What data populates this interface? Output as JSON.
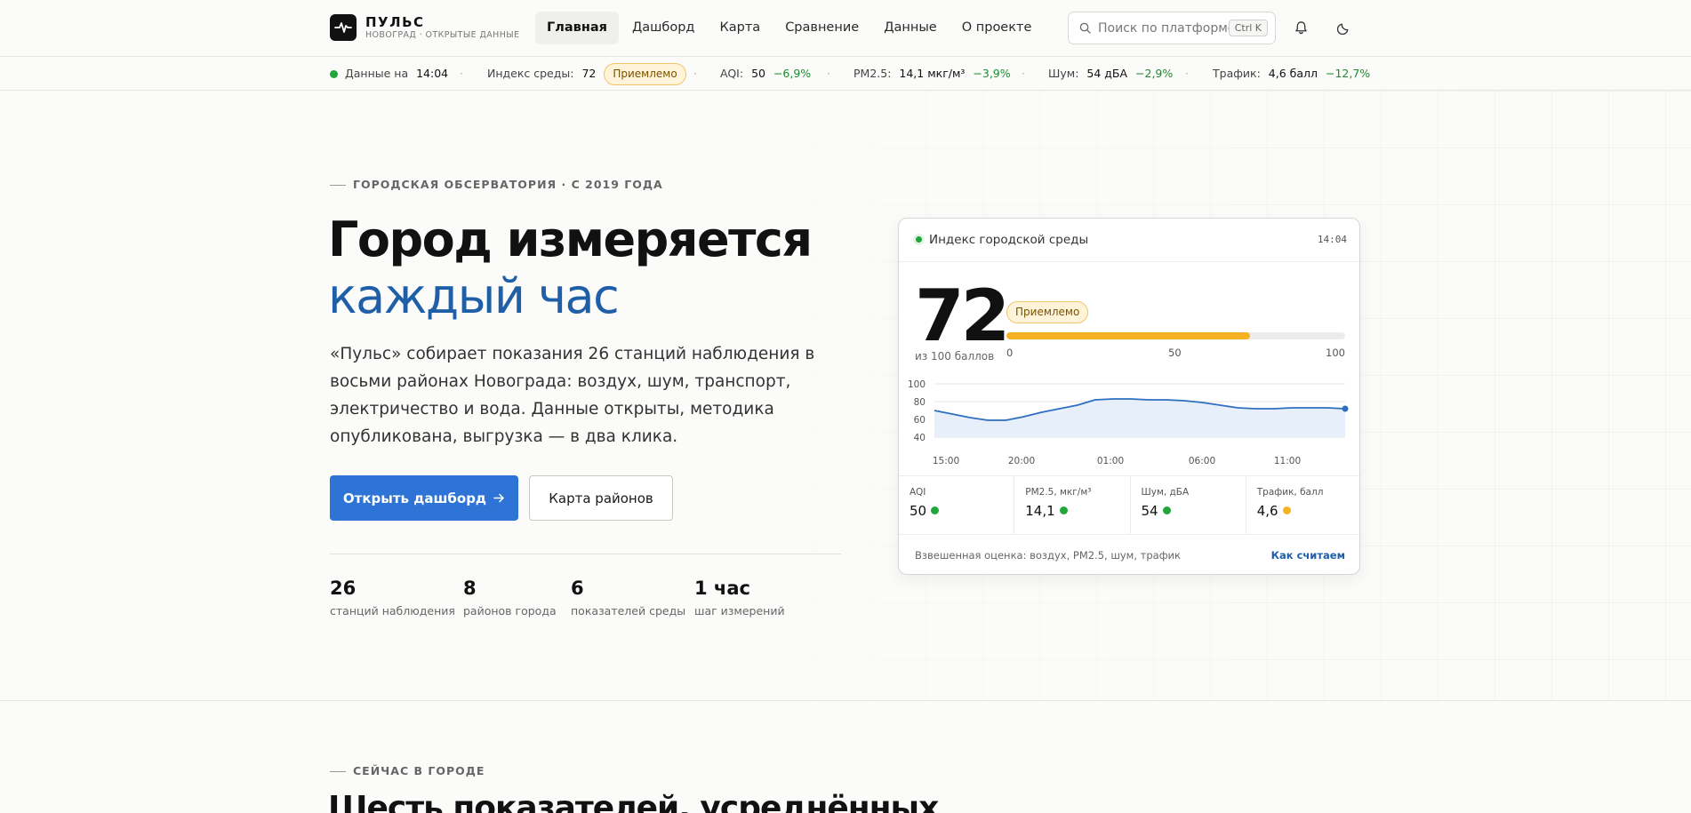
{
  "brand": {
    "name": "ПУЛЬС",
    "subtitle": "НОВОГРАД · ОТКРЫТЫЕ ДАННЫЕ"
  },
  "nav": [
    {
      "label": "Главная",
      "active": true
    },
    {
      "label": "Дашборд",
      "active": false
    },
    {
      "label": "Карта",
      "active": false
    },
    {
      "label": "Сравнение",
      "active": false
    },
    {
      "label": "Данные",
      "active": false
    },
    {
      "label": "О проекте",
      "active": false
    }
  ],
  "search": {
    "placeholder": "Поиск по платформе",
    "shortcut": "Ctrl K"
  },
  "ticker": {
    "data_label": "Данные на",
    "data_time": "14:04",
    "index_label": "Индекс среды:",
    "index_value": "72",
    "index_status": "Приемлемо",
    "aqi_label": "AQI:",
    "aqi_value": "50",
    "aqi_delta": "−6,9%",
    "pm_label": "PM2.5:",
    "pm_value": "14,1 мкг/м³",
    "pm_delta": "−3,9%",
    "noise_label": "Шум:",
    "noise_value": "54 дБА",
    "noise_delta": "−2,9%",
    "traffic_label": "Трафик:",
    "traffic_value": "4,6 балл",
    "traffic_delta": "−12,7%"
  },
  "hero": {
    "eyebrow": "ГОРОДСКАЯ ОБСЕРВАТОРИЯ · С 2019 ГОДА",
    "title_line1": "Город измеряется",
    "title_line2": "каждый час",
    "lead": "«Пульс» собирает показания 26 станций наблюдения в восьми районах Новограда: воздух, шум, транспорт, электричество и вода. Данные открыты, методика опубликована, выгрузка — в два клика.",
    "primary_cta": "Открыть дашборд",
    "secondary_cta": "Карта районов",
    "stats": [
      {
        "value": "26",
        "label": "станций наблюдения"
      },
      {
        "value": "8",
        "label": "районов города"
      },
      {
        "value": "6",
        "label": "показателей среды"
      },
      {
        "value": "1 час",
        "label": "шаг измерений"
      }
    ]
  },
  "card": {
    "title": "Индекс городской среды",
    "time": "14:04",
    "score": "72",
    "score_caption": "из 100 баллов",
    "status": "Приемлемо",
    "score_fraction": 0.72,
    "scale": [
      "0",
      "50",
      "100"
    ],
    "metrics": [
      {
        "label": "AQI",
        "value": "50",
        "status_color": "#22a53a"
      },
      {
        "label": "PM2.5, мкг/м³",
        "value": "14,1",
        "status_color": "#22a53a"
      },
      {
        "label": "Шум, дБА",
        "value": "54",
        "status_color": "#22a53a"
      },
      {
        "label": "Трафик, балл",
        "value": "4,6",
        "status_color": "#f5b323"
      }
    ],
    "footer_text": "Взвешенная оценка: воздух, PM2.5, шум, трафик",
    "footer_link": "Как считаем"
  },
  "chart_data": {
    "type": "area",
    "x_ticks": [
      "15:00",
      "20:00",
      "01:00",
      "06:00",
      "11:00"
    ],
    "y_ticks": [
      "100",
      "80",
      "60",
      "40"
    ],
    "ylim": [
      40,
      100
    ],
    "grid": true,
    "series": [
      {
        "values": [
          70,
          66,
          62,
          59,
          59,
          63,
          68,
          72,
          76,
          82,
          83,
          83,
          82,
          82,
          81,
          79,
          76,
          73,
          72,
          72,
          73,
          73,
          73,
          72
        ]
      }
    ],
    "line_color": "#2f6fc0",
    "fill_color": "#e3edf9"
  },
  "section2": {
    "eyebrow": "СЕЙЧАС В ГОРОДЕ",
    "title": "Шесть показателей, усреднённых"
  },
  "colors": {
    "accent": "#2d74d6",
    "brand_blue": "#1f5fa8",
    "good": "#22a53a",
    "warn": "#f5b323"
  }
}
